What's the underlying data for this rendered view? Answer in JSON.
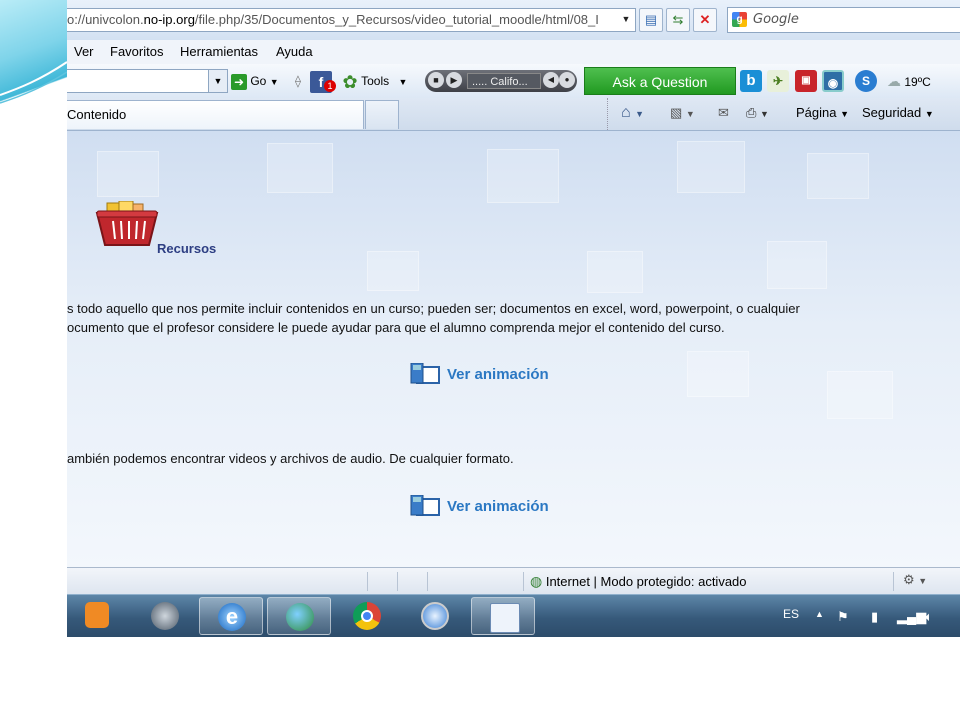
{
  "browser": {
    "url_prefix": "o://univcolon.",
    "url_domain": "no-ip.org",
    "url_path": "/file.php/35/Documentos_y_Recursos/video_tutorial_moodle/html/08_I",
    "search_placeholder": "Google"
  },
  "menu": [
    "Ver",
    "Favoritos",
    "Herramientas",
    "Ayuda"
  ],
  "toolbar": {
    "go_label": "Go",
    "tools_label": "Tools",
    "player_text": "..... Califo...",
    "ask_label": "Ask a Question",
    "weather_temp": "19ºC",
    "fb_badge": "1"
  },
  "tabs": {
    "active_label": "Contenido"
  },
  "commands": {
    "page_label": "Página",
    "security_label": "Seguridad"
  },
  "content": {
    "section_title": "Recursos",
    "para1_line1": "s todo aquello que nos permite incluir contenidos en un curso; pueden ser; documentos en excel, word, powerpoint, o cualquier",
    "para1_line2": "ocumento que el profesor considere le puede ayudar para que el alumno comprenda mejor el contenido del curso.",
    "anim_label_1": "Ver animación",
    "para2": "ambién podemos encontrar videos y archivos de audio. De cualquier formato.",
    "anim_label_2": "Ver animación"
  },
  "status": {
    "zone_text": "Internet | Modo protegido: activado"
  },
  "taskbar": {
    "language": "ES"
  }
}
